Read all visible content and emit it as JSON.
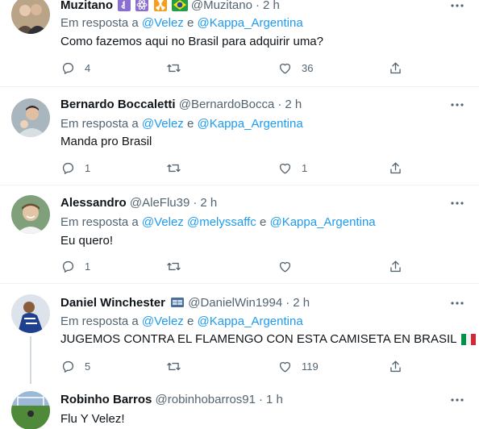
{
  "reply_prefix": "Em resposta a",
  "and_word": "e",
  "dot": "·",
  "tweets": [
    {
      "name": "Muzitano",
      "handle": "@Muzitano",
      "time": "2 h",
      "mentions": [
        "@Velez",
        "@Kappa_Argentina"
      ],
      "text": "Como fazemos aqui no Brasil para adquirir uma?",
      "replies": "4",
      "retweets": "",
      "likes": "36",
      "badges": [
        "medical-icon",
        "atom-icon",
        "radioactive-icon",
        "brazil-flag-icon"
      ]
    },
    {
      "name": "Bernardo Boccaletti",
      "handle": "@BernardoBocca",
      "time": "2 h",
      "mentions": [
        "@Velez",
        "@Kappa_Argentina"
      ],
      "text": "Manda pro Brasil",
      "replies": "1",
      "retweets": "",
      "likes": "1"
    },
    {
      "name": "Alessandro",
      "handle": "@AleFlu39",
      "time": "2 h",
      "mentions": [
        "@Velez",
        "@melyssaffc",
        "@Kappa_Argentina"
      ],
      "text": "Eu quero!",
      "replies": "1",
      "retweets": "",
      "likes": ""
    },
    {
      "name": "Daniel Winchester",
      "handle": "@DanielWin1994",
      "time": "2 h",
      "mentions": [
        "@Velez",
        "@Kappa_Argentina"
      ],
      "text": "JUGEMOS CONTRA EL FLAMENGO CON ESTA CAMISETA EN BRASIL",
      "replies": "5",
      "retweets": "",
      "likes": "119",
      "badges": [
        "stadium-icon",
        "italy-flag-icon",
        "hungary-flag-icon"
      ]
    },
    {
      "name": "Robinho Barros",
      "handle": "@robinhobarros91",
      "time": "1 h",
      "text": "Flu Y Velez!"
    }
  ],
  "colors": {
    "accent": "#1d9bf0",
    "secondary_text": "#536471",
    "primary_text": "#0f1419",
    "divider": "#eff3f4"
  }
}
